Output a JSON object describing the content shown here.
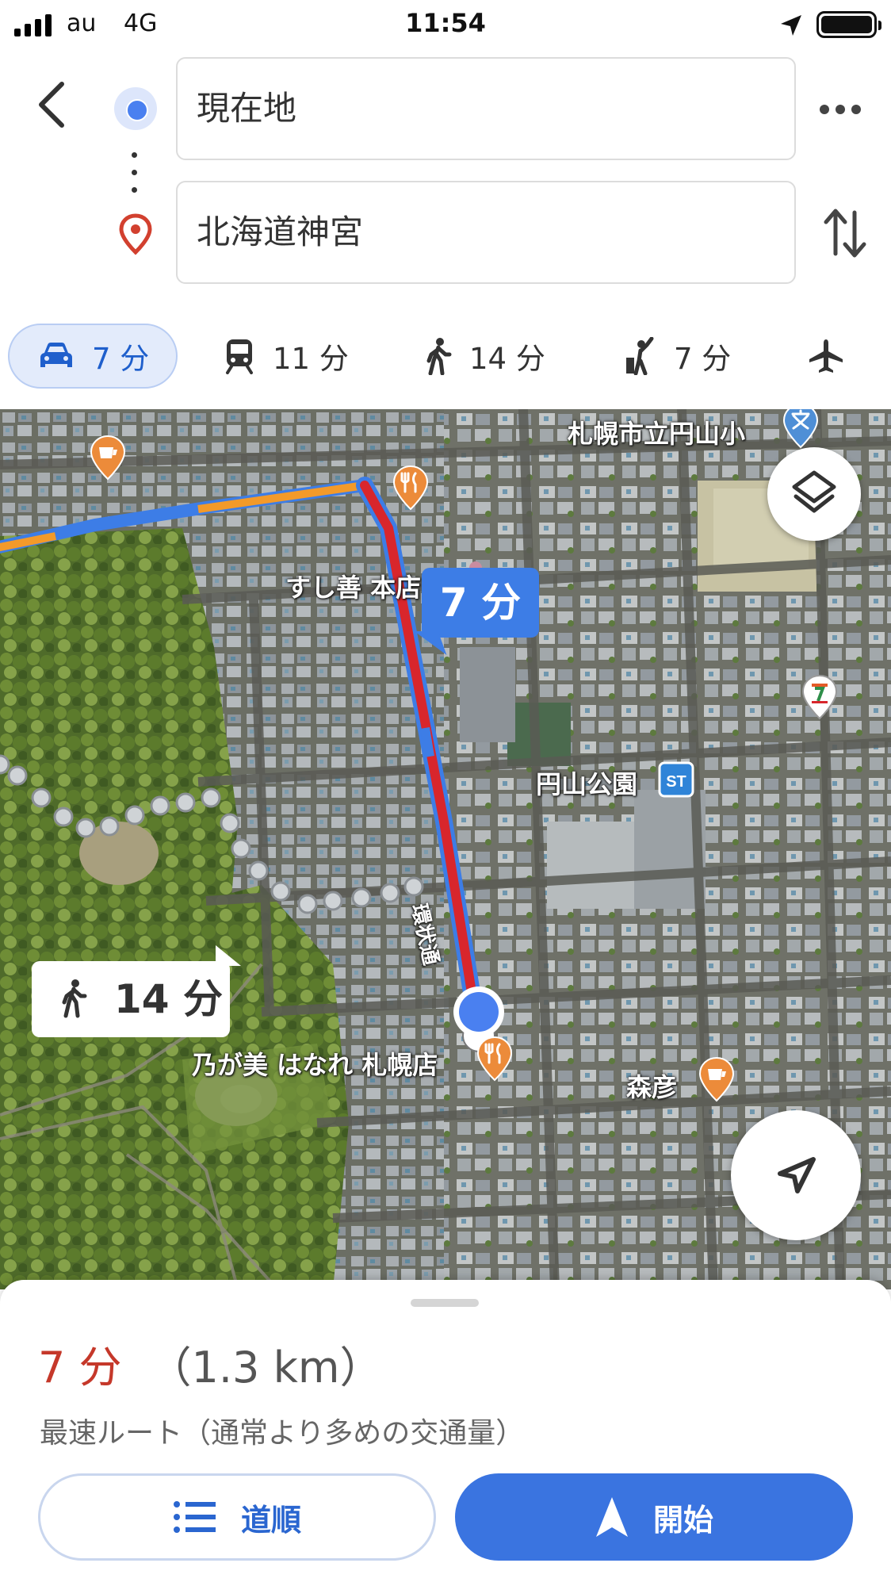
{
  "status_bar": {
    "carrier": "au",
    "network": "4G",
    "time": "11:54"
  },
  "directions": {
    "origin_value": "現在地",
    "destination_value": "北海道神宮"
  },
  "modes": [
    {
      "icon": "car-icon",
      "label": "7 分",
      "selected": true
    },
    {
      "icon": "train-icon",
      "label": "11 分",
      "selected": false
    },
    {
      "icon": "walk-icon",
      "label": "14 分",
      "selected": false
    },
    {
      "icon": "ride-hail-icon",
      "label": "7 分",
      "selected": false
    },
    {
      "icon": "flight-icon",
      "label": "",
      "selected": false
    }
  ],
  "map": {
    "labels": {
      "school": "札幌市立円山小",
      "sushi": "すし善 本店",
      "station": "円山公園",
      "road": "環状通",
      "restaurant": "乃が美 はなれ 札幌店",
      "cafe": "森彦"
    },
    "drive_bubble": "7 分",
    "walk_bubble": "14 分",
    "colors": {
      "route_primary": "#d8262c",
      "route_blue": "#3d7de6",
      "traffic_orange": "#f39a2a",
      "user_dot": "#4a80f0"
    }
  },
  "summary": {
    "eta": "7 分",
    "distance": "（1.3 km）",
    "description": "最速ルート（通常より多めの交通量）",
    "steps_button": "道順",
    "start_button": "開始"
  }
}
